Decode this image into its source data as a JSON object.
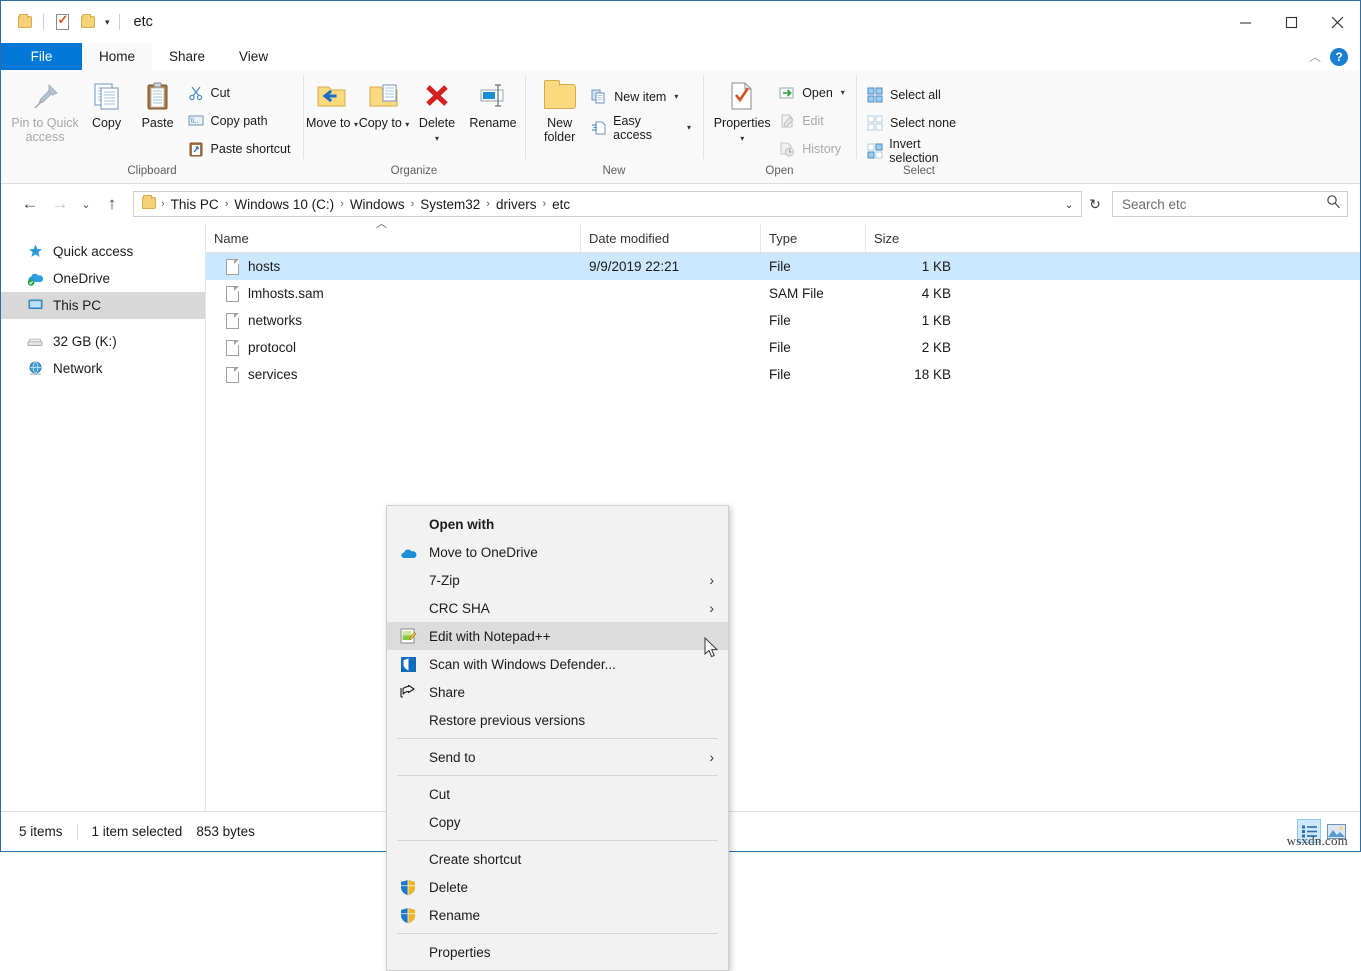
{
  "window": {
    "title": "etc",
    "quick_access_icons": [
      "folder-icon",
      "properties-check-icon",
      "folder-icon",
      "dropdown-caret-icon"
    ],
    "controls": {
      "minimize": "minimize-icon",
      "maximize": "maximize-icon",
      "close": "close-icon"
    },
    "ribbon_collapse": "chevron-up-icon",
    "help": "?"
  },
  "tabs": [
    {
      "label": "File",
      "kind": "file"
    },
    {
      "label": "Home",
      "kind": "active"
    },
    {
      "label": "Share",
      "kind": "normal"
    },
    {
      "label": "View",
      "kind": "normal"
    }
  ],
  "ribbon": {
    "groups": [
      {
        "label": "Clipboard",
        "big": [
          {
            "label": "Pin to Quick access",
            "icon": "pin-icon",
            "dim": true
          },
          {
            "label": "Copy",
            "icon": "copy-icon",
            "dim": false
          },
          {
            "label": "Paste",
            "icon": "paste-icon",
            "dim": false
          }
        ],
        "small": [
          {
            "label": "Cut",
            "icon": "scissors-icon",
            "dim": false
          },
          {
            "label": "Copy path",
            "icon": "copy-path-icon",
            "dim": false
          },
          {
            "label": "Paste shortcut",
            "icon": "paste-shortcut-icon",
            "dim": false
          }
        ]
      },
      {
        "label": "Organize",
        "big": [
          {
            "label": "Move to",
            "icon": "move-to-icon",
            "caret": true
          },
          {
            "label": "Copy to",
            "icon": "copy-to-icon",
            "caret": true
          },
          {
            "label": "Delete",
            "icon": "delete-x-icon",
            "caret": true
          },
          {
            "label": "Rename",
            "icon": "rename-icon",
            "caret": false
          }
        ],
        "small": []
      },
      {
        "label": "New",
        "big": [
          {
            "label": "New folder",
            "icon": "new-folder-icon",
            "dim": false
          }
        ],
        "small": [
          {
            "label": "New item",
            "icon": "new-item-icon",
            "caret": true
          },
          {
            "label": "Easy access",
            "icon": "easy-access-icon",
            "caret": true
          }
        ]
      },
      {
        "label": "Open",
        "big": [
          {
            "label": "Properties",
            "icon": "properties-icon",
            "caret": true
          }
        ],
        "small": [
          {
            "label": "Open",
            "icon": "open-arrow-icon",
            "caret": true,
            "dim": false
          },
          {
            "label": "Edit",
            "icon": "edit-icon",
            "dim": true
          },
          {
            "label": "History",
            "icon": "history-icon",
            "dim": true
          }
        ]
      },
      {
        "label": "Select",
        "big": [],
        "small": [
          {
            "label": "Select all",
            "icon": "select-all-icon",
            "dim": false
          },
          {
            "label": "Select none",
            "icon": "select-none-icon",
            "dim": false
          },
          {
            "label": "Invert selection",
            "icon": "invert-selection-icon",
            "dim": false
          }
        ]
      }
    ]
  },
  "addressbar": {
    "back": "back-arrow-icon",
    "forward": "forward-arrow-icon",
    "recent": "chevron-down-icon",
    "up": "up-arrow-icon",
    "breadcrumbs": [
      "This PC",
      "Windows 10 (C:)",
      "Windows",
      "System32",
      "drivers",
      "etc"
    ],
    "refresh": "refresh-icon",
    "search_placeholder": "Search etc",
    "search_value": ""
  },
  "navpane": {
    "items": [
      {
        "label": "Quick access",
        "icon": "star-pin-icon",
        "selected": false
      },
      {
        "label": "OneDrive",
        "icon": "onedrive-cloud-icon",
        "selected": false
      },
      {
        "label": "This PC",
        "icon": "this-pc-monitor-icon",
        "selected": true
      },
      {
        "label": "32 GB (K:)",
        "icon": "usb-drive-icon",
        "selected": false
      },
      {
        "label": "Network",
        "icon": "network-globe-icon",
        "selected": false
      }
    ]
  },
  "filelist": {
    "columns": [
      "Name",
      "Date modified",
      "Type",
      "Size"
    ],
    "sort_indicator": "ascending",
    "rows": [
      {
        "name": "hosts",
        "date": "9/9/2019 22:21",
        "type": "File",
        "size": "1 KB",
        "selected": true
      },
      {
        "name": "lmhosts.sam",
        "date": "",
        "type": "SAM File",
        "size": "4 KB",
        "selected": false
      },
      {
        "name": "networks",
        "date": "",
        "type": "File",
        "size": "1 KB",
        "selected": false
      },
      {
        "name": "protocol",
        "date": "",
        "type": "File",
        "size": "2 KB",
        "selected": false
      },
      {
        "name": "services",
        "date": "",
        "type": "File",
        "size": "18 KB",
        "selected": false
      }
    ]
  },
  "contextmenu": {
    "items": [
      {
        "label": "Open with",
        "icon": "",
        "bold": true,
        "submenu": false,
        "highlighted": false
      },
      {
        "label": "Move to OneDrive",
        "icon": "onedrive-cloud-icon",
        "bold": false,
        "submenu": false,
        "highlighted": false
      },
      {
        "label": "7-Zip",
        "icon": "",
        "bold": false,
        "submenu": true,
        "highlighted": false
      },
      {
        "label": "CRC SHA",
        "icon": "",
        "bold": false,
        "submenu": true,
        "highlighted": false
      },
      {
        "label": "Edit with Notepad++",
        "icon": "notepadpp-icon",
        "bold": false,
        "submenu": false,
        "highlighted": true
      },
      {
        "label": "Scan with Windows Defender...",
        "icon": "defender-shield-icon",
        "bold": false,
        "submenu": false,
        "highlighted": false
      },
      {
        "label": "Share",
        "icon": "share-arrow-icon",
        "bold": false,
        "submenu": false,
        "highlighted": false
      },
      {
        "label": "Restore previous versions",
        "icon": "",
        "bold": false,
        "submenu": false,
        "highlighted": false
      },
      {
        "separator": true
      },
      {
        "label": "Send to",
        "icon": "",
        "bold": false,
        "submenu": true,
        "highlighted": false
      },
      {
        "separator": true
      },
      {
        "label": "Cut",
        "icon": "",
        "bold": false,
        "submenu": false,
        "highlighted": false
      },
      {
        "label": "Copy",
        "icon": "",
        "bold": false,
        "submenu": false,
        "highlighted": false
      },
      {
        "separator": true
      },
      {
        "label": "Create shortcut",
        "icon": "",
        "bold": false,
        "submenu": false,
        "highlighted": false
      },
      {
        "label": "Delete",
        "icon": "uac-shield-icon",
        "bold": false,
        "submenu": false,
        "highlighted": false
      },
      {
        "label": "Rename",
        "icon": "uac-shield-icon",
        "bold": false,
        "submenu": false,
        "highlighted": false
      },
      {
        "separator": true
      },
      {
        "label": "Properties",
        "icon": "",
        "bold": false,
        "submenu": false,
        "highlighted": false
      }
    ]
  },
  "statusbar": {
    "item_count": "5 items",
    "selection": "1 item selected",
    "selection_size": "853 bytes",
    "view_details": "details-view-icon",
    "view_thumbnails": "thumbnail-view-icon",
    "watermark": "wsxdn.com"
  },
  "colors": {
    "accent": "#0078d7",
    "selection": "#cce8ff",
    "menu_bg": "#f2f2f2",
    "menu_hover": "#dcdcdc",
    "ribbon_bg": "#f9f9f9"
  }
}
